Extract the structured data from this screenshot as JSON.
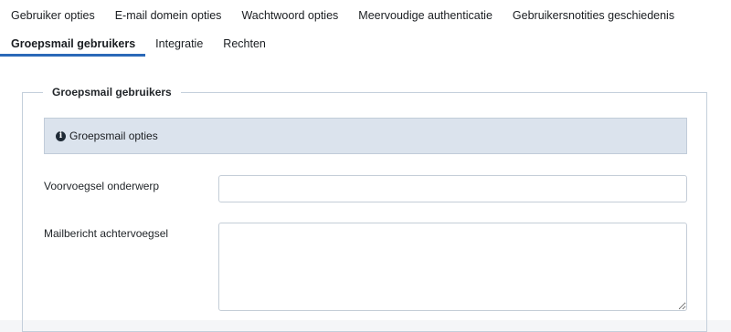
{
  "tabs": {
    "row1": [
      {
        "label": "Gebruiker opties",
        "name": "tab-gebruiker-opties"
      },
      {
        "label": "E-mail domein opties",
        "name": "tab-email-domein-opties"
      },
      {
        "label": "Wachtwoord opties",
        "name": "tab-wachtwoord-opties"
      },
      {
        "label": "Meervoudige authenticatie",
        "name": "tab-meervoudige-authenticatie"
      },
      {
        "label": "Gebruikersnotities geschiedenis",
        "name": "tab-gebruikersnotities-geschiedenis"
      }
    ],
    "row2": [
      {
        "label": "Groepsmail gebruikers",
        "name": "tab-groepsmail-gebruikers",
        "active": true
      },
      {
        "label": "Integratie",
        "name": "tab-integratie"
      },
      {
        "label": "Rechten",
        "name": "tab-rechten"
      }
    ]
  },
  "fieldset": {
    "legend": "Groepsmail gebruikers",
    "info": {
      "icon": "info-circle-icon",
      "text": "Groepsmail opties"
    },
    "fields": {
      "subject_prefix": {
        "label": "Voorvoegsel onderwerp",
        "value": ""
      },
      "mail_suffix": {
        "label": "Mailbericht achtervoegsel",
        "value": ""
      }
    }
  },
  "colors": {
    "active_tab_underline": "#2a69b8",
    "info_background": "#dbe3ed",
    "fieldset_border": "#c4cfdb"
  }
}
